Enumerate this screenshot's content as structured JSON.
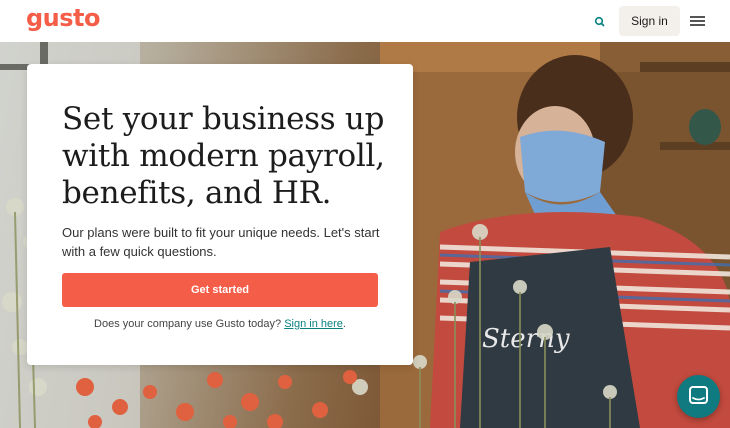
{
  "header": {
    "logo": "gusto",
    "search_icon": "search-icon",
    "sign_in_label": "Sign in",
    "menu_icon": "hamburger-menu-icon"
  },
  "hero": {
    "apron_text": "Sterny"
  },
  "card": {
    "title": "Set your business up with modern payroll, benefits, and HR.",
    "subtitle": "Our plans were built to fit your unique needs. Let's start with a few quick questions.",
    "cta_label": "Get started",
    "footer_prefix": "Does your company use Gusto today?",
    "footer_link": "Sign in here",
    "footer_suffix": "."
  },
  "chat": {
    "icon": "chat-icon"
  },
  "colors": {
    "brand": "#f45d48",
    "link": "#0a8080",
    "chat": "#0f7a80"
  }
}
